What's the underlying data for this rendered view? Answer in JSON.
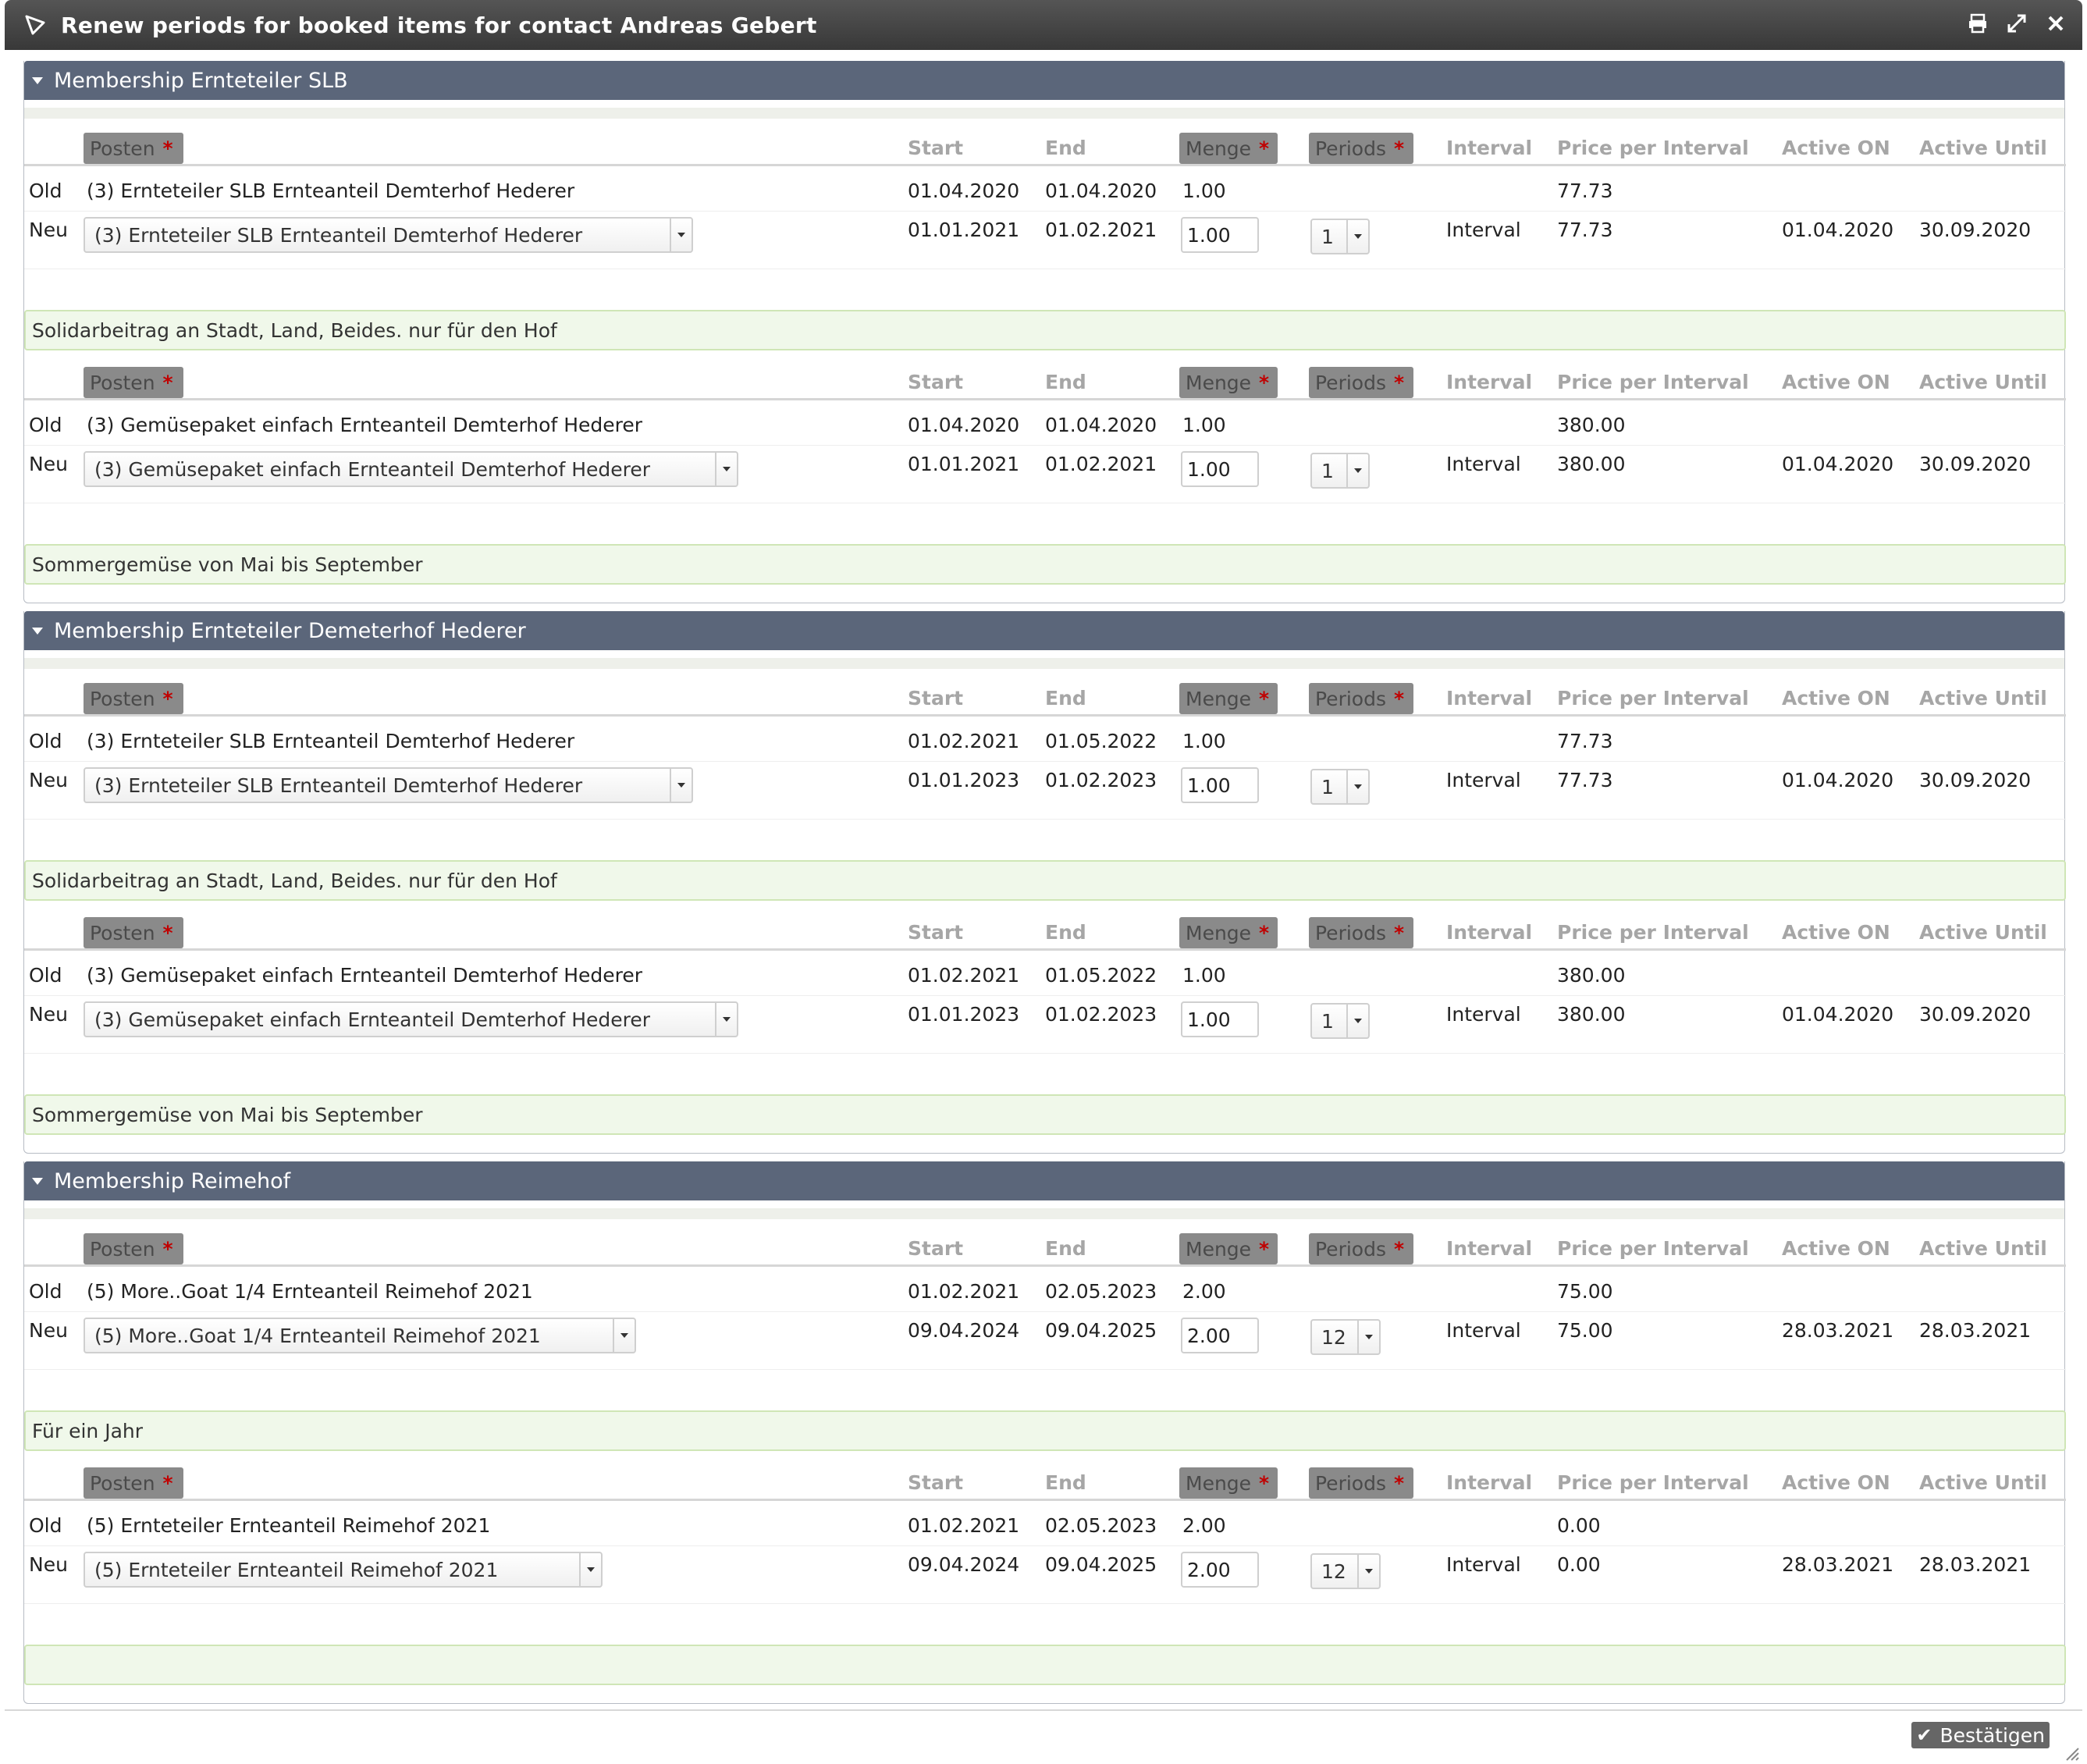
{
  "window": {
    "title": "Renew periods for booked items for contact Andreas Gebert"
  },
  "columns": {
    "posten": "Posten",
    "start": "Start",
    "end": "End",
    "menge": "Menge",
    "periods": "Periods",
    "interval": "Interval",
    "price_per_interval": "Price per Interval",
    "active_on": "Active ON",
    "active_until": "Active Until",
    "required_mark": "*"
  },
  "row_labels": {
    "old": "Old",
    "new": "Neu"
  },
  "memberships": [
    {
      "title": "Membership Ernteteiler SLB",
      "items": [
        {
          "old": {
            "posten": "(3) Ernteteiler SLB Ernteanteil Demterhof Hederer",
            "start": "01.04.2020",
            "end": "01.04.2020",
            "menge": "1.00",
            "price": "77.73"
          },
          "new": {
            "posten": "(3) Ernteteiler SLB Ernteanteil Demterhof Hederer",
            "start": "01.01.2021",
            "end": "01.02.2021",
            "menge": "1.00",
            "periods": "1",
            "interval": "Interval",
            "price": "77.73",
            "active_on": "01.04.2020",
            "active_until": "30.09.2020"
          },
          "description": "Solidarbeitrag an Stadt, Land, Beides. nur für den Hof"
        },
        {
          "old": {
            "posten": "(3) Gemüsepaket einfach Ernteanteil Demterhof Hederer",
            "start": "01.04.2020",
            "end": "01.04.2020",
            "menge": "1.00",
            "price": "380.00"
          },
          "new": {
            "posten": "(3) Gemüsepaket einfach Ernteanteil Demterhof Hederer",
            "start": "01.01.2021",
            "end": "01.02.2021",
            "menge": "1.00",
            "periods": "1",
            "interval": "Interval",
            "price": "380.00",
            "active_on": "01.04.2020",
            "active_until": "30.09.2020"
          },
          "description": "Sommergemüse von Mai bis September"
        }
      ]
    },
    {
      "title": "Membership Ernteteiler Demeterhof Hederer",
      "items": [
        {
          "old": {
            "posten": "(3) Ernteteiler SLB Ernteanteil Demterhof Hederer",
            "start": "01.02.2021",
            "end": "01.05.2022",
            "menge": "1.00",
            "price": "77.73"
          },
          "new": {
            "posten": "(3) Ernteteiler SLB Ernteanteil Demterhof Hederer",
            "start": "01.01.2023",
            "end": "01.02.2023",
            "menge": "1.00",
            "periods": "1",
            "interval": "Interval",
            "price": "77.73",
            "active_on": "01.04.2020",
            "active_until": "30.09.2020"
          },
          "description": "Solidarbeitrag an Stadt, Land, Beides. nur für den Hof"
        },
        {
          "old": {
            "posten": "(3) Gemüsepaket einfach Ernteanteil Demterhof Hederer",
            "start": "01.02.2021",
            "end": "01.05.2022",
            "menge": "1.00",
            "price": "380.00"
          },
          "new": {
            "posten": "(3) Gemüsepaket einfach Ernteanteil Demterhof Hederer",
            "start": "01.01.2023",
            "end": "01.02.2023",
            "menge": "1.00",
            "periods": "1",
            "interval": "Interval",
            "price": "380.00",
            "active_on": "01.04.2020",
            "active_until": "30.09.2020"
          },
          "description": "Sommergemüse von Mai bis September"
        }
      ]
    },
    {
      "title": "Membership Reimehof",
      "items": [
        {
          "old": {
            "posten": "(5) More..Goat 1/4 Ernteanteil Reimehof 2021",
            "start": "01.02.2021",
            "end": "02.05.2023",
            "menge": "2.00",
            "price": "75.00"
          },
          "new": {
            "posten": "(5) More..Goat 1/4 Ernteanteil Reimehof 2021",
            "start": "09.04.2024",
            "end": "09.04.2025",
            "menge": "2.00",
            "periods": "12",
            "interval": "Interval",
            "price": "75.00",
            "active_on": "28.03.2021",
            "active_until": "28.03.2021"
          },
          "description": "Für ein Jahr"
        },
        {
          "old": {
            "posten": "(5) Ernteteiler Ernteanteil Reimehof 2021",
            "start": "01.02.2021",
            "end": "02.05.2023",
            "menge": "2.00",
            "price": "0.00"
          },
          "new": {
            "posten": "(5) Ernteteiler Ernteanteil Reimehof 2021",
            "start": "09.04.2024",
            "end": "09.04.2025",
            "menge": "2.00",
            "periods": "12",
            "interval": "Interval",
            "price": "0.00",
            "active_on": "28.03.2021",
            "active_until": "28.03.2021"
          },
          "description": ""
        }
      ]
    }
  ],
  "footer": {
    "confirm_label": "Bestätigen"
  }
}
